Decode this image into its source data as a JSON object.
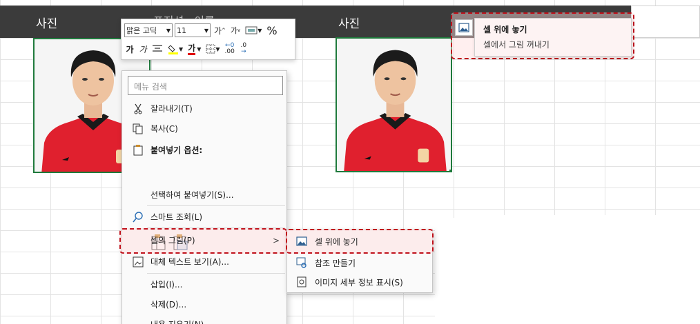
{
  "sheet": {
    "header_left": "사진",
    "header_mid_partial": "포지션 · 이름",
    "header_right": "사진"
  },
  "mini_toolbar": {
    "font_name": "맑은 고딕",
    "font_size": "11",
    "grow_font": "가",
    "shrink_font": "가",
    "percent": "%",
    "bold": "가",
    "italic": "가",
    "font_color_letter": "가",
    "dec_increase": ".00",
    "dec_decrease": ".0"
  },
  "context_menu": {
    "search_placeholder": "메뉴 검색",
    "cut": "잘라내기(T)",
    "copy": "복사(C)",
    "paste_options": "붙여넣기 옵션:",
    "paste_special": "선택하여 붙여넣기(S)...",
    "smart_lookup": "스마트 조회(L)",
    "picture_in_cell": "셀의 그림(P)",
    "alt_text": "대체 텍스트 보기(A)...",
    "insert": "삽입(I)...",
    "delete": "삭제(D)...",
    "clear_contents": "내용 지우기(N)"
  },
  "submenu": {
    "place_over_cells": "셀 위에 놓기",
    "create_reference": "참조 만들기",
    "show_image_details": "이미지 세부 정보 표시(S)"
  },
  "popup": {
    "title": "셀 위에 놓기",
    "desc": "셀에서 그림 꺼내기"
  },
  "colors": {
    "header_bg": "#3b3b3b",
    "cell_border": "#1f7a3c",
    "highlight_dash": "#c0111b",
    "jersey_red": "#e0202e"
  }
}
